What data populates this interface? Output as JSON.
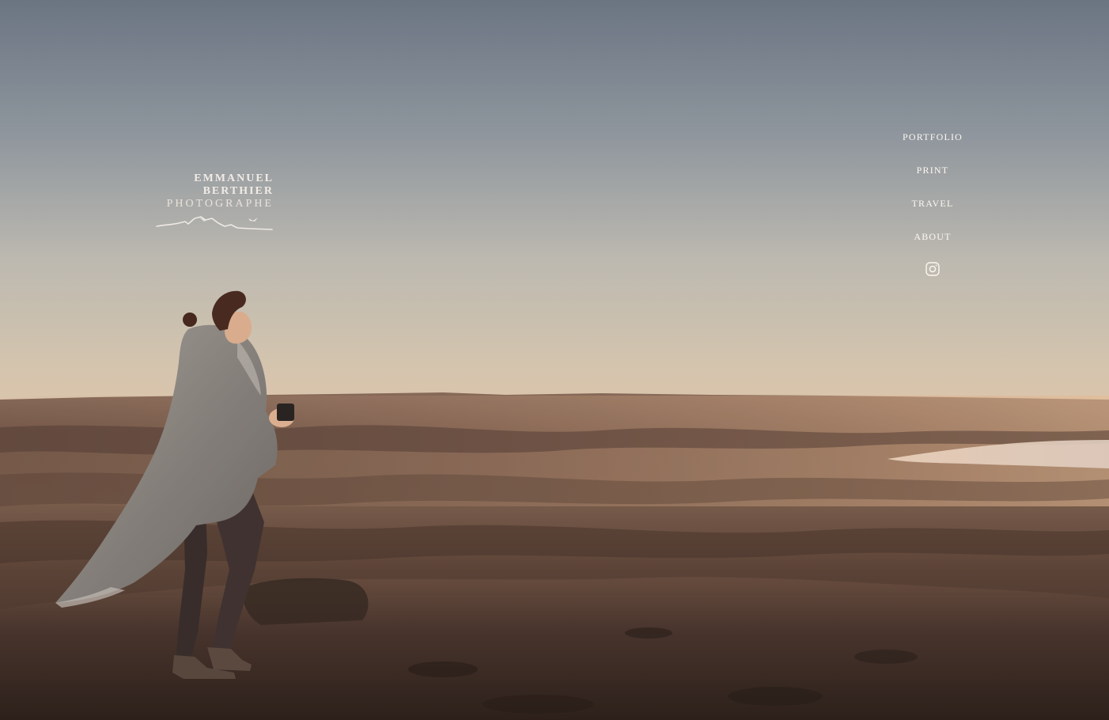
{
  "logo": {
    "line1": "EMMANUEL",
    "line2": "BERTHIER",
    "line3": "PHOTOGRAPHE",
    "mark_icon": "mountain-bird-icon"
  },
  "nav": {
    "items": [
      {
        "label": "PORTFOLIO"
      },
      {
        "label": "PRINT"
      },
      {
        "label": "TRAVEL"
      },
      {
        "label": "ABOUT"
      }
    ],
    "social_icon": "instagram-icon"
  },
  "colors": {
    "sky_top": "#7e8693",
    "sky_mid": "#c9c2b8",
    "horizon_glow": "#f3c7a0",
    "land_dark": "#3a2a24",
    "nav_text": "#fdf8f2"
  }
}
